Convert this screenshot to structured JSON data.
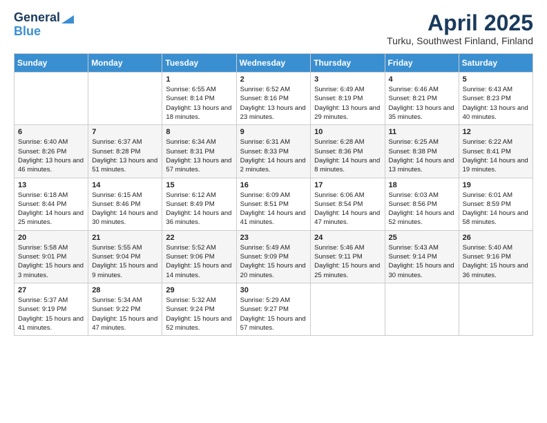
{
  "logo": {
    "line1": "General",
    "line2": "Blue"
  },
  "title": "April 2025",
  "subtitle": "Turku, Southwest Finland, Finland",
  "days_of_week": [
    "Sunday",
    "Monday",
    "Tuesday",
    "Wednesday",
    "Thursday",
    "Friday",
    "Saturday"
  ],
  "weeks": [
    [
      {
        "num": "",
        "info": ""
      },
      {
        "num": "",
        "info": ""
      },
      {
        "num": "1",
        "info": "Sunrise: 6:55 AM\nSunset: 8:14 PM\nDaylight: 13 hours and 18 minutes."
      },
      {
        "num": "2",
        "info": "Sunrise: 6:52 AM\nSunset: 8:16 PM\nDaylight: 13 hours and 23 minutes."
      },
      {
        "num": "3",
        "info": "Sunrise: 6:49 AM\nSunset: 8:19 PM\nDaylight: 13 hours and 29 minutes."
      },
      {
        "num": "4",
        "info": "Sunrise: 6:46 AM\nSunset: 8:21 PM\nDaylight: 13 hours and 35 minutes."
      },
      {
        "num": "5",
        "info": "Sunrise: 6:43 AM\nSunset: 8:23 PM\nDaylight: 13 hours and 40 minutes."
      }
    ],
    [
      {
        "num": "6",
        "info": "Sunrise: 6:40 AM\nSunset: 8:26 PM\nDaylight: 13 hours and 46 minutes."
      },
      {
        "num": "7",
        "info": "Sunrise: 6:37 AM\nSunset: 8:28 PM\nDaylight: 13 hours and 51 minutes."
      },
      {
        "num": "8",
        "info": "Sunrise: 6:34 AM\nSunset: 8:31 PM\nDaylight: 13 hours and 57 minutes."
      },
      {
        "num": "9",
        "info": "Sunrise: 6:31 AM\nSunset: 8:33 PM\nDaylight: 14 hours and 2 minutes."
      },
      {
        "num": "10",
        "info": "Sunrise: 6:28 AM\nSunset: 8:36 PM\nDaylight: 14 hours and 8 minutes."
      },
      {
        "num": "11",
        "info": "Sunrise: 6:25 AM\nSunset: 8:38 PM\nDaylight: 14 hours and 13 minutes."
      },
      {
        "num": "12",
        "info": "Sunrise: 6:22 AM\nSunset: 8:41 PM\nDaylight: 14 hours and 19 minutes."
      }
    ],
    [
      {
        "num": "13",
        "info": "Sunrise: 6:18 AM\nSunset: 8:44 PM\nDaylight: 14 hours and 25 minutes."
      },
      {
        "num": "14",
        "info": "Sunrise: 6:15 AM\nSunset: 8:46 PM\nDaylight: 14 hours and 30 minutes."
      },
      {
        "num": "15",
        "info": "Sunrise: 6:12 AM\nSunset: 8:49 PM\nDaylight: 14 hours and 36 minutes."
      },
      {
        "num": "16",
        "info": "Sunrise: 6:09 AM\nSunset: 8:51 PM\nDaylight: 14 hours and 41 minutes."
      },
      {
        "num": "17",
        "info": "Sunrise: 6:06 AM\nSunset: 8:54 PM\nDaylight: 14 hours and 47 minutes."
      },
      {
        "num": "18",
        "info": "Sunrise: 6:03 AM\nSunset: 8:56 PM\nDaylight: 14 hours and 52 minutes."
      },
      {
        "num": "19",
        "info": "Sunrise: 6:01 AM\nSunset: 8:59 PM\nDaylight: 14 hours and 58 minutes."
      }
    ],
    [
      {
        "num": "20",
        "info": "Sunrise: 5:58 AM\nSunset: 9:01 PM\nDaylight: 15 hours and 3 minutes."
      },
      {
        "num": "21",
        "info": "Sunrise: 5:55 AM\nSunset: 9:04 PM\nDaylight: 15 hours and 9 minutes."
      },
      {
        "num": "22",
        "info": "Sunrise: 5:52 AM\nSunset: 9:06 PM\nDaylight: 15 hours and 14 minutes."
      },
      {
        "num": "23",
        "info": "Sunrise: 5:49 AM\nSunset: 9:09 PM\nDaylight: 15 hours and 20 minutes."
      },
      {
        "num": "24",
        "info": "Sunrise: 5:46 AM\nSunset: 9:11 PM\nDaylight: 15 hours and 25 minutes."
      },
      {
        "num": "25",
        "info": "Sunrise: 5:43 AM\nSunset: 9:14 PM\nDaylight: 15 hours and 30 minutes."
      },
      {
        "num": "26",
        "info": "Sunrise: 5:40 AM\nSunset: 9:16 PM\nDaylight: 15 hours and 36 minutes."
      }
    ],
    [
      {
        "num": "27",
        "info": "Sunrise: 5:37 AM\nSunset: 9:19 PM\nDaylight: 15 hours and 41 minutes."
      },
      {
        "num": "28",
        "info": "Sunrise: 5:34 AM\nSunset: 9:22 PM\nDaylight: 15 hours and 47 minutes."
      },
      {
        "num": "29",
        "info": "Sunrise: 5:32 AM\nSunset: 9:24 PM\nDaylight: 15 hours and 52 minutes."
      },
      {
        "num": "30",
        "info": "Sunrise: 5:29 AM\nSunset: 9:27 PM\nDaylight: 15 hours and 57 minutes."
      },
      {
        "num": "",
        "info": ""
      },
      {
        "num": "",
        "info": ""
      },
      {
        "num": "",
        "info": ""
      }
    ]
  ]
}
